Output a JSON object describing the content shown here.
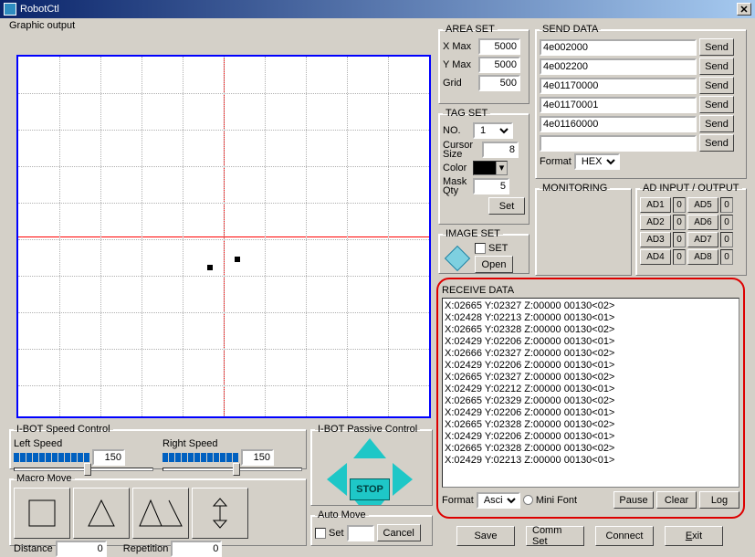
{
  "window": {
    "title": "RobotCtl"
  },
  "graphicOutput": {
    "title": "Graphic output"
  },
  "areaSet": {
    "title": "AREA SET",
    "xmax_label": "X Max",
    "xmax": "5000",
    "ymax_label": "Y Max",
    "ymax": "5000",
    "grid_label": "Grid",
    "grid": "500"
  },
  "tagSet": {
    "title": "TAG SET",
    "no_label": "NO.",
    "no_value": "1",
    "cursor_label": "Cursor Size",
    "cursor": "8",
    "color_label": "Color",
    "mask_label": "Mask Qty",
    "mask": "5",
    "set_label": "Set"
  },
  "imageSet": {
    "title": "IMAGE SET",
    "set_label": "SET",
    "open_label": "Open"
  },
  "sendData": {
    "title": "SEND DATA",
    "send_label": "Send",
    "rows": [
      "4e002000",
      "4e002200",
      "4e01170000",
      "4e01170001",
      "4e01160000",
      ""
    ],
    "format_label": "Format",
    "format_value": "HEX"
  },
  "monitoring": {
    "title": "MONITORING"
  },
  "adio": {
    "title": "AD INPUT / OUTPUT",
    "ad1": "AD1",
    "ad2": "AD2",
    "ad3": "AD3",
    "ad4": "AD4",
    "ad5": "AD5",
    "ad6": "AD6",
    "ad7": "AD7",
    "ad8": "AD8",
    "v": "0"
  },
  "receive": {
    "title": "RECEIVE DATA",
    "lines": [
      "X:02665  Y:02327  Z:00000 00130<02>",
      "X:02428  Y:02213  Z:00000 00130<01>",
      "X:02665  Y:02328  Z:00000 00130<02>",
      "X:02429  Y:02206  Z:00000 00130<01>",
      "X:02666  Y:02327  Z:00000 00130<02>",
      "X:02429  Y:02206  Z:00000 00130<01>",
      "X:02665  Y:02327  Z:00000 00130<02>",
      "X:02429  Y:02212  Z:00000 00130<01>",
      "X:02665  Y:02329  Z:00000 00130<02>",
      "X:02429  Y:02206  Z:00000 00130<01>",
      "X:02665  Y:02328  Z:00000 00130<02>",
      "X:02429  Y:02206  Z:00000 00130<01>",
      "X:02665  Y:02328  Z:00000 00130<02>",
      "X:02429  Y:02213  Z:00000 00130<01>"
    ],
    "format_label": "Format",
    "format_value": "Ascii",
    "mini_label": "Mini Font",
    "pause_label": "Pause",
    "clear_label": "Clear",
    "log_label": "Log"
  },
  "speed": {
    "title": "I-BOT Speed Control",
    "left_label": "Left Speed",
    "left": "150",
    "right_label": "Right Speed",
    "right": "150"
  },
  "passive": {
    "title": "I-BOT Passive Control",
    "stop": "STOP"
  },
  "macro": {
    "title": "Macro Move",
    "dist_label": "Distance",
    "dist": "0",
    "rep_label": "Repetition",
    "rep": "0"
  },
  "autoMove": {
    "title": "Auto Move",
    "set_label": "Set",
    "cancel_label": "Cancel"
  },
  "bottom": {
    "save": "Save",
    "commset": "Comm Set",
    "connect": "Connect",
    "exit": "Exit"
  }
}
